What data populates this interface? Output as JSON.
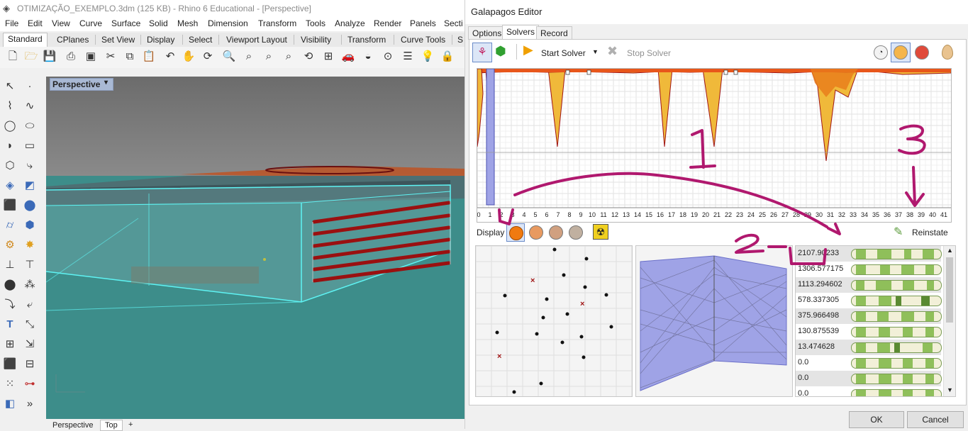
{
  "rhino": {
    "title": "OTIMIZAÇÃO_EXEMPLO.3dm (125 KB) - Rhino 6 Educational - [Perspective]",
    "menu": [
      "File",
      "Edit",
      "View",
      "Curve",
      "Surface",
      "Solid",
      "Mesh",
      "Dimension",
      "Transform",
      "Tools",
      "Analyze",
      "Render",
      "Panels",
      "Secti"
    ],
    "toolbar_tabs": [
      "Standard",
      "CPlanes",
      "Set View",
      "Display",
      "Select",
      "Viewport Layout",
      "Visibility",
      "Transform",
      "Curve Tools",
      "S"
    ],
    "viewport_label": "Perspective",
    "viewport_tabs": [
      "Perspective",
      "Top",
      "+"
    ]
  },
  "galapagos": {
    "title": "Galapagos Editor",
    "tabs": [
      "Options",
      "Solvers",
      "Record"
    ],
    "selected_tab": "Solvers",
    "toolbar": {
      "start_solver": "Start Solver",
      "stop_solver": "Stop Solver"
    },
    "generation_ticks": [
      "0",
      "1",
      "2",
      "3",
      "4",
      "5",
      "6",
      "7",
      "8",
      "9",
      "10",
      "11",
      "12",
      "13",
      "14",
      "15",
      "16",
      "17",
      "18",
      "19",
      "20",
      "21",
      "22",
      "23",
      "24",
      "25",
      "26",
      "27",
      "28",
      "29",
      "30",
      "31",
      "32",
      "33",
      "34",
      "35",
      "36",
      "37",
      "38",
      "39",
      "40",
      "41"
    ],
    "display_label": "Display",
    "reinstate_label": "Reinstate",
    "fitness_values": [
      "2107.90233",
      "1306.577175",
      "1113.294602",
      "578.337305",
      "375.966498",
      "130.875539",
      "13.474628",
      "0.0",
      "0.0",
      "0.0"
    ],
    "ok_label": "OK",
    "cancel_label": "Cancel",
    "annotations": [
      "1",
      "2",
      "3"
    ]
  },
  "colors": {
    "graph_fill": "#f0b93a",
    "graph_line": "#a01515",
    "annotation": "#b0186e",
    "parallel_fill": "#9fa3e6",
    "gene_green": "#8fbf5a",
    "viewport_floor": "#3d8d8a"
  }
}
